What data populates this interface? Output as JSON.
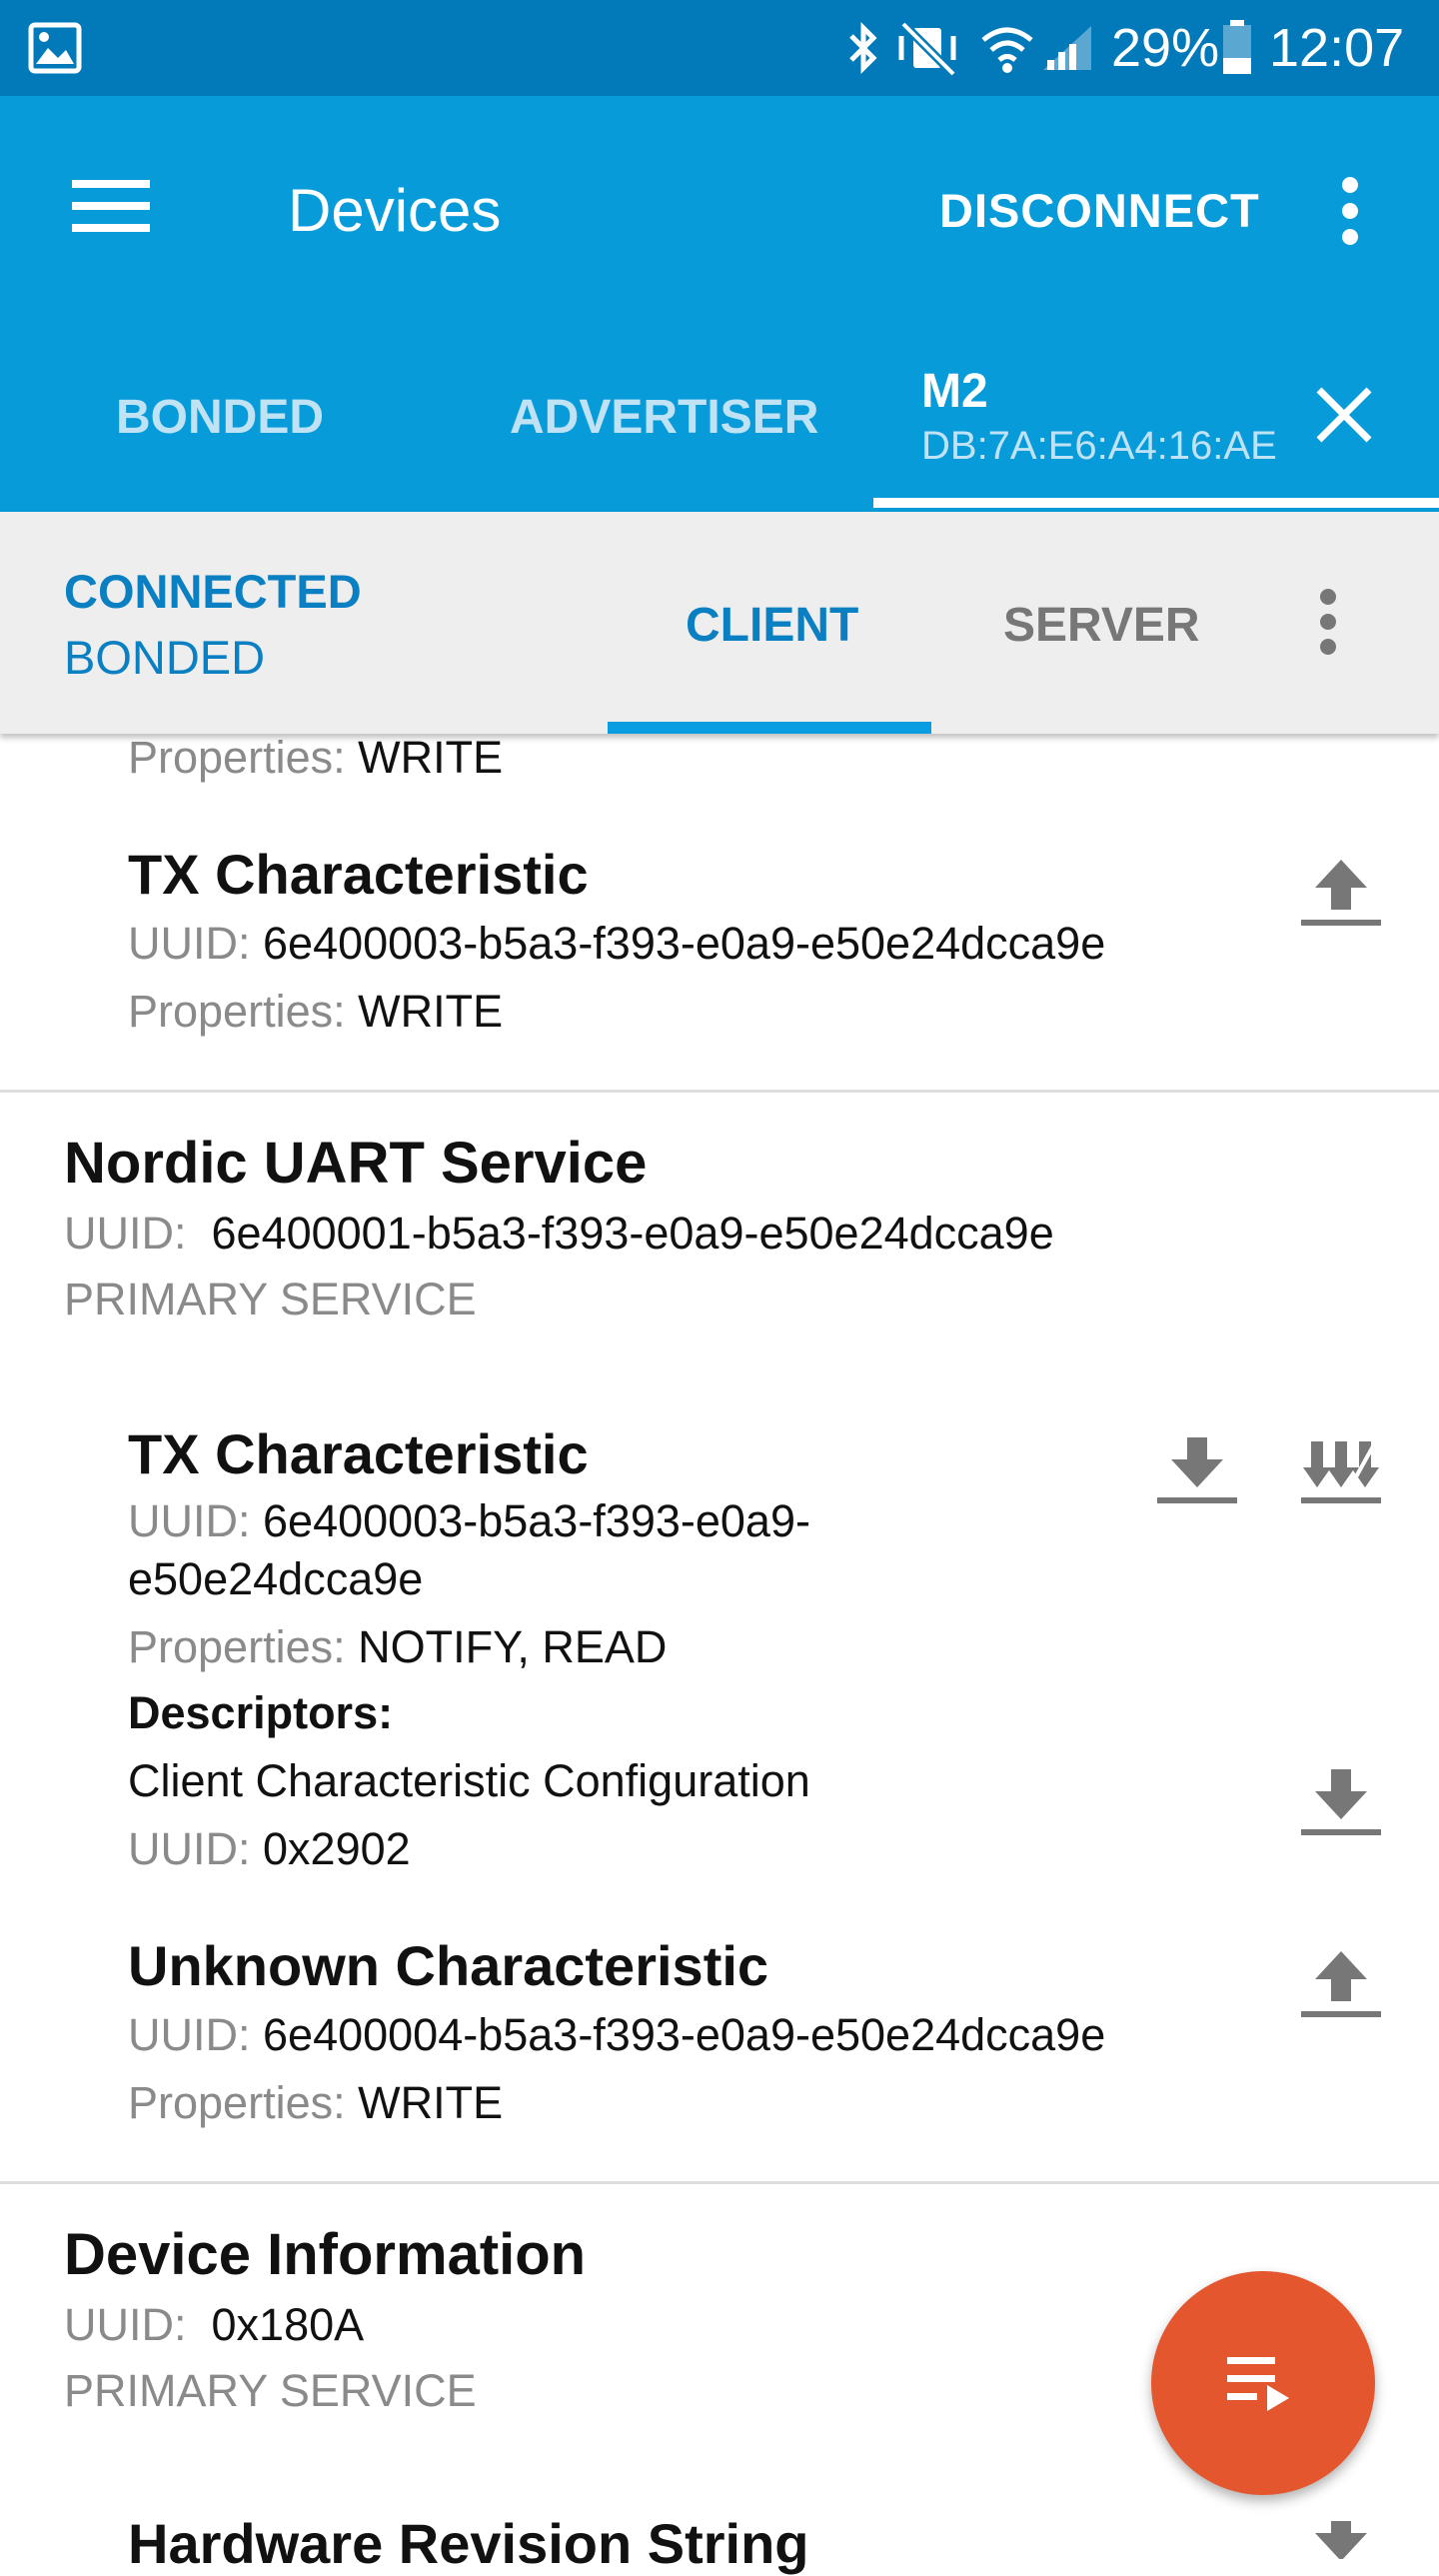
{
  "status_bar": {
    "battery": "29%",
    "time": "12:07",
    "icons": [
      "image-icon",
      "bluetooth-icon",
      "vibrate-mute-icon",
      "wifi-icon",
      "signal-icon",
      "battery-icon"
    ]
  },
  "app_bar": {
    "title": "Devices",
    "disconnect_label": "DISCONNECT",
    "tabs": [
      {
        "label": "BONDED"
      },
      {
        "label": "ADVERTISER"
      },
      {
        "label": "M2",
        "address": "DB:7A:E6:A4:16:AE",
        "selected": true
      }
    ]
  },
  "connection": {
    "state": "CONNECTED",
    "bond_state": "BONDED",
    "tabs": [
      "CLIENT",
      "SERVER"
    ],
    "selected_tab": "CLIENT"
  },
  "labels": {
    "uuid": "UUID:",
    "properties": "Properties:",
    "descriptors": "Descriptors:"
  },
  "partial_top": {
    "properties": "WRITE"
  },
  "char_tx_top": {
    "name": "TX Characteristic",
    "uuid": "6e400003-b5a3-f393-e0a9-e50e24dcca9e",
    "properties": "WRITE"
  },
  "service_uart": {
    "name": "Nordic UART Service",
    "uuid": "6e400001-b5a3-f393-e0a9-e50e24dcca9e",
    "type": "PRIMARY SERVICE"
  },
  "char_tx": {
    "name": "TX Characteristic",
    "uuid_line1": "6e400003-b5a3-f393-e0a9-",
    "uuid_line2": "e50e24dcca9e",
    "properties": "NOTIFY, READ",
    "descriptor_name": "Client Characteristic Configuration",
    "descriptor_uuid": "0x2902"
  },
  "char_unknown": {
    "name": "Unknown Characteristic",
    "uuid": "6e400004-b5a3-f393-e0a9-e50e24dcca9e",
    "properties": "WRITE"
  },
  "service_devinfo": {
    "name": "Device Information",
    "uuid": "0x180A",
    "type": "PRIMARY SERVICE"
  },
  "char_hw_rev": {
    "name": "Hardware Revision String"
  },
  "colors": {
    "status_bar": "#0279b8",
    "app_bar": "#079bd9",
    "accent": "#0a7fc1",
    "fab": "#e4572e"
  }
}
